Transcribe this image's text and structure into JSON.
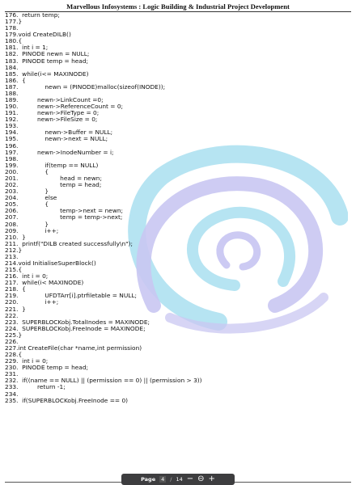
{
  "header": {
    "title": "Marvellous Infosystems : Logic Building & Industrial Project Development"
  },
  "code_lines": [
    "176.  return temp;",
    "177.}",
    "178.",
    "179.void CreateDILB()",
    "180.{",
    "181.  int i = 1;",
    "182.  PINODE newn = NULL;",
    "183.  PINODE temp = head;",
    "184.",
    "185.  while(i<= MAXINODE)",
    "186.  {",
    "187.              newn = (PINODE)malloc(sizeof(INODE));",
    "188.",
    "189.          newn->LinkCount =0;",
    "190.          newn->ReferenceCount = 0;",
    "191.          newn->FileType = 0;",
    "192.          newn->FileSize = 0;",
    "193.",
    "194.              newn->Buffer = NULL;",
    "195.              newn->next = NULL;",
    "196.",
    "197.          newn->InodeNumber = i;",
    "198.",
    "199.              if(temp == NULL)",
    "200.              {",
    "201.                      head = newn;",
    "202.                      temp = head;",
    "203.              }",
    "204.              else",
    "205.              {",
    "206.                      temp->next = newn;",
    "207.                      temp = temp->next;",
    "208.              }",
    "209.              i++;",
    "210.  }",
    "211.  printf(\"DILB created successfully\\n\");",
    "212.}",
    "213.",
    "214.void InitialiseSuperBlock()",
    "215.{",
    "216.  int i = 0;",
    "217.  while(i< MAXINODE)",
    "218.  {",
    "219.              UFDTArr[i].ptrfiletable = NULL;",
    "220.              i++;",
    "221.  }",
    "222.",
    "223.  SUPERBLOCKobj.TotalInodes = MAXINODE;",
    "224.  SUPERBLOCKobj.FreeInode = MAXINODE;",
    "225.}",
    "226.",
    "227.int CreateFile(char *name,int permission)",
    "228.{",
    "229.  int i = 0;",
    "230.  PINODE temp = head;",
    "231.",
    "232.  if((name == NULL) || (permission == 0) || (permission > 3))",
    "233.          return -1;",
    "234.",
    "235.  if(SUPERBLOCKobj.FreeInode == 0)"
  ],
  "toolbar": {
    "page_label": "Page",
    "current_page": "4",
    "separator": "/",
    "total_pages": "14",
    "zoom_out": "−",
    "zoom_reset": "⊖",
    "zoom_in": "+"
  },
  "colors": {
    "watermark_blue": "#a9dff0",
    "watermark_purple": "#c9c7f2",
    "toolbar_bg": "#3d3d3f"
  }
}
